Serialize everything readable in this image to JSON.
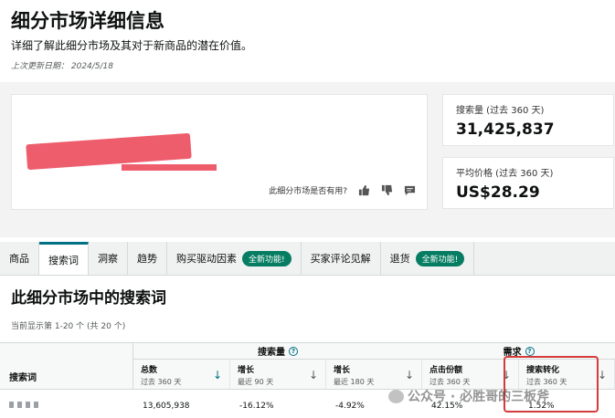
{
  "header": {
    "title": "细分市场详细信息",
    "subtitle": "详细了解此细分市场及其对于新商品的潜在价值。",
    "updated": "上次更新日期：  2024/5/18"
  },
  "summary": {
    "helpful_prompt": "此细分市场是否有用?",
    "search_volume_label": "搜索量 (过去 360 天)",
    "search_volume_value": "31,425,837",
    "avg_price_label": "平均价格 (过去 360 天)",
    "avg_price_value": "US$28.29"
  },
  "tabs": [
    {
      "label": "商品"
    },
    {
      "label": "搜索词"
    },
    {
      "label": "洞察"
    },
    {
      "label": "趋势"
    },
    {
      "label": "购买驱动因素",
      "badge": "全新功能!"
    },
    {
      "label": "买家评论见解"
    },
    {
      "label": "退货",
      "badge": "全新功能!"
    }
  ],
  "section": {
    "title": "此细分市场中的搜索词",
    "showing": "当前显示第 1-20 个 (共 20 个)"
  },
  "table": {
    "keyword_header": "搜索词",
    "group_search_volume": "搜索量",
    "group_demand": "需求",
    "columns": [
      {
        "h": "总数",
        "s": "过去 360 天"
      },
      {
        "h": "增长",
        "s": "最近 90 天"
      },
      {
        "h": "增长",
        "s": "最近 180 天"
      },
      {
        "h": "点击份额",
        "s": "过去 360 天"
      },
      {
        "h": "搜索转化",
        "s": "过去 360 天"
      }
    ],
    "row": {
      "total": "13,605,938",
      "growth90": "-16.12%",
      "growth180": "-4.92%",
      "click_share": "42.15%",
      "conversion": "1.52%"
    }
  },
  "watermark": "公众号 · 必胜哥的三板斧",
  "colors": {
    "accent": "#007185",
    "badge": "#067d62",
    "highlight": "#d63b3b",
    "redaction": "#ee5d6c"
  }
}
